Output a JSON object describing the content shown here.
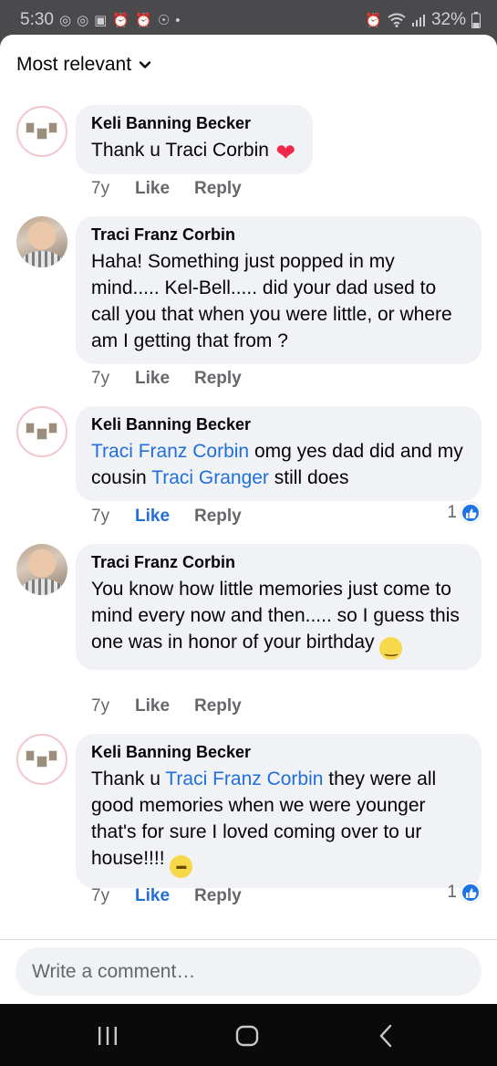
{
  "status_bar": {
    "time": "5:30",
    "battery": "32%",
    "left_icons": [
      "threads-icon",
      "threads-icon",
      "calendar-icon",
      "alarm-icon",
      "alarm-icon",
      "messenger-icon",
      "dot-icon"
    ],
    "right_icons": [
      "alarm-icon",
      "wifi-icon",
      "signal-icon",
      "battery-icon"
    ]
  },
  "sort": {
    "label": "Most relevant"
  },
  "comments": [
    {
      "author": "Keli Banning Becker",
      "avatar": "collage",
      "parts": [
        {
          "t": "Thank u Traci Corbin "
        }
      ],
      "emoji": "heart-emoji",
      "time": "7y",
      "like": "Like",
      "like_active": false,
      "reply": "Reply",
      "reactions": ""
    },
    {
      "author": "Traci Franz Corbin",
      "avatar": "photo",
      "parts": [
        {
          "t": "Haha! Something just popped in my mind..... Kel-Bell..... did your dad used to call you that when you were little, or where am I getting that from ?"
        }
      ],
      "time": "7y",
      "like": "Like",
      "like_active": false,
      "reply": "Reply",
      "reactions": ""
    },
    {
      "author": "Keli Banning Becker",
      "avatar": "collage",
      "parts": [
        {
          "t": "Traci Franz Corbin",
          "mention": true
        },
        {
          "t": " omg yes dad did and my cousin "
        },
        {
          "t": "Traci Granger",
          "mention": true
        },
        {
          "t": " still does"
        }
      ],
      "time": "7y",
      "like": "Like",
      "like_active": true,
      "reply": "Reply",
      "reactions": "1"
    },
    {
      "author": "Traci Franz Corbin",
      "avatar": "photo",
      "parts": [
        {
          "t": "You know how little memories just come to mind every now and then..... so I guess this one was in honor of your birthday "
        }
      ],
      "emoji": "smile-emoji",
      "time": "7y",
      "like": "Like",
      "like_active": false,
      "reply": "Reply",
      "reactions": ""
    },
    {
      "author": "Keli Banning Becker",
      "avatar": "collage",
      "parts": [
        {
          "t": "Thank u "
        },
        {
          "t": "Traci Franz Corbin",
          "mention": true
        },
        {
          "t": " they were all good memories when we were younger that's for sure I loved coming over to ur house!!!! "
        }
      ],
      "emoji": "grin-emoji",
      "time": "7y",
      "like": "Like",
      "like_active": true,
      "reply": "Reply",
      "reactions": "1"
    }
  ],
  "composer": {
    "placeholder": "Write a comment…"
  },
  "nav": [
    "recent-apps-icon",
    "home-icon",
    "back-icon"
  ],
  "colors": {
    "mention": "#216fdb",
    "bubble": "#f0f2f5",
    "secondary_text": "#65676b",
    "like_reaction": "#1b74e4"
  }
}
